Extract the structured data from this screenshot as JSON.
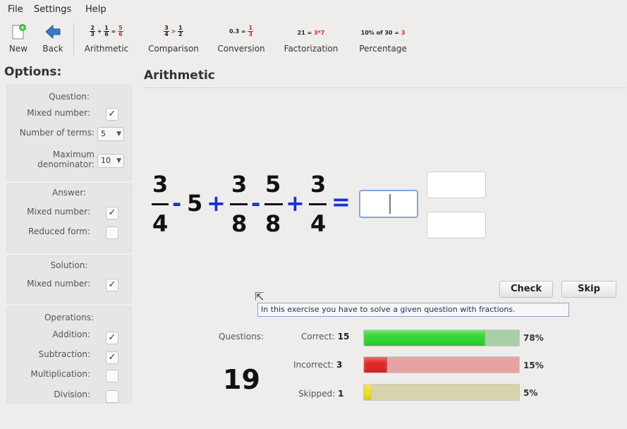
{
  "menu": {
    "file": "File",
    "settings": "Settings",
    "help": "Help"
  },
  "toolbar": {
    "new_label": "New",
    "back_label": "Back",
    "arithmetic_label": "Arithmetic",
    "comparison_label": "Comparison",
    "conversion_label": "Conversion",
    "factorization_label": "Factorization",
    "percentage_label": "Percentage",
    "conversion_icon_text": "0.3̄ =",
    "factorization_icon_text": "21 =",
    "factorization_icon_result": "3*7",
    "percentage_icon_text": "10% of 30 =",
    "percentage_icon_result": "3",
    "comparison_icon_op": ">"
  },
  "sidebar": {
    "title": "Options:",
    "question": {
      "title": "Question:",
      "mixed_number_label": "Mixed number:",
      "mixed_number_checked": "✓",
      "terms_label": "Number of terms:",
      "terms_value": "5",
      "max_denom_label": "Maximum denominator:",
      "max_denom_value": "10"
    },
    "answer": {
      "title": "Answer:",
      "mixed_number_label": "Mixed number:",
      "mixed_number_checked": "✓",
      "reduced_label": "Reduced form:"
    },
    "solution": {
      "title": "Solution:",
      "mixed_number_label": "Mixed number:",
      "mixed_number_checked": "✓"
    },
    "operations": {
      "title": "Operations:",
      "addition_label": "Addition:",
      "addition_checked": "✓",
      "subtraction_label": "Subtraction:",
      "subtraction_checked": "✓",
      "multiplication_label": "Multiplication:",
      "division_label": "Division:"
    }
  },
  "main": {
    "title": "Arithmetic",
    "equation": {
      "t1_num": "3",
      "t1_den": "4",
      "op1": "-",
      "t2": "5",
      "op2": "+",
      "t3_num": "3",
      "t3_den": "8",
      "op3": "-",
      "t4_num": "5",
      "t4_den": "8",
      "op4": "+",
      "t5_num": "3",
      "t5_den": "4",
      "equals": "="
    },
    "check_label": "Check",
    "skip_label": "Skip",
    "tooltip": "In this exercise you have to solve a given question with fractions."
  },
  "stats": {
    "questions_label": "Questions:",
    "questions_count": "19",
    "correct_label": "Correct:",
    "correct_count": "15",
    "correct_pct": "78%",
    "correct_fraction": 0.78,
    "incorrect_label": "Incorrect:",
    "incorrect_count": "3",
    "incorrect_pct": "15%",
    "incorrect_fraction": 0.15,
    "skipped_label": "Skipped:",
    "skipped_count": "1",
    "skipped_pct": "5%",
    "skipped_fraction": 0.05
  },
  "colors": {
    "correct_fill": "#33d633",
    "correct_track": "#a9cfa9",
    "incorrect_fill": "#e02828",
    "incorrect_track": "#e7a3a3",
    "skipped_fill": "#f0e020",
    "skipped_track": "#d6d4aa",
    "operator_blue": "#1a2fd8"
  }
}
